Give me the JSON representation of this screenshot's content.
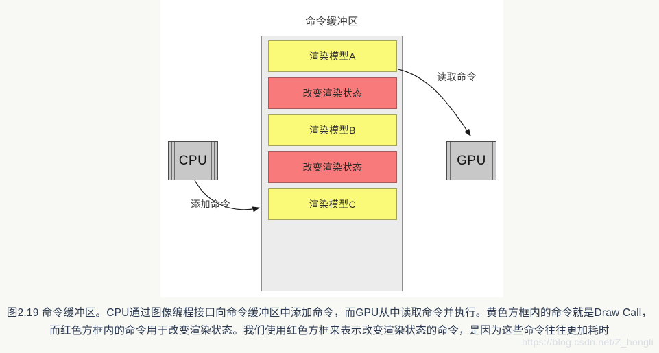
{
  "diagram": {
    "title": "命令缓冲区",
    "command_buffer": {
      "name": "命令缓冲区",
      "fill_color": "#ececec",
      "border_color": "#8c8c8c",
      "commands": [
        {
          "label": "渲染模型A",
          "kind": "draw-call",
          "color": "#fafa78"
        },
        {
          "label": "改变渲染状态",
          "kind": "state-change",
          "color": "#f97a7a"
        },
        {
          "label": "渲染模型B",
          "kind": "draw-call",
          "color": "#fafa78"
        },
        {
          "label": "改变渲染状态",
          "kind": "state-change",
          "color": "#f97a7a"
        },
        {
          "label": "渲染模型C",
          "kind": "draw-call",
          "color": "#fafa78"
        }
      ]
    },
    "processors": {
      "cpu": {
        "label": "CPU",
        "color": "#c8c8c8"
      },
      "gpu": {
        "label": "GPU",
        "color": "#c8c8c8"
      }
    },
    "arrows": {
      "add": {
        "label": "添加命令",
        "from": "CPU",
        "to": "命令缓冲区"
      },
      "read": {
        "label": "读取命令",
        "from": "命令缓冲区",
        "to": "GPU"
      }
    }
  },
  "caption": {
    "line1": "图2.19 命令缓冲区。CPU通过图像编程接口向命令缓冲区中添加命令，而GPU从中读取命令并执行。黄色方框内的命令就是Draw Call，",
    "line2": "而红色方框内的命令用于改变渲染状态。我们使用红色方框来表示改变渲染状态的命令，是因为这些命令往往更加耗时",
    "text_color": "#2b3a52"
  },
  "watermark": {
    "text": "https://blog.csdn.net/Z_hongli"
  }
}
